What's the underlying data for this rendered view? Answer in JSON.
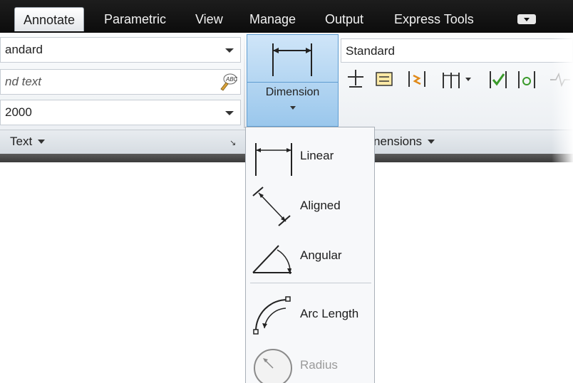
{
  "tabs": [
    {
      "label": "Annotate",
      "active": true
    },
    {
      "label": "Parametric",
      "active": false
    },
    {
      "label": "View",
      "active": false
    },
    {
      "label": "Manage",
      "active": false
    },
    {
      "label": "Output",
      "active": false
    },
    {
      "label": "Express Tools",
      "active": false
    }
  ],
  "text_panel": {
    "style_value": "andard",
    "find_placeholder": "nd text",
    "height_value": "2000",
    "title": "Text"
  },
  "dimensions_panel": {
    "dimension_button_label": "Dimension",
    "style_value": "Standard",
    "title_partial": "nensions"
  },
  "dimension_menu": {
    "items": [
      {
        "label": "Linear",
        "icon": "linear-dimension-icon",
        "enabled": true
      },
      {
        "label": "Aligned",
        "icon": "aligned-dimension-icon",
        "enabled": true
      },
      {
        "label": "Angular",
        "icon": "angular-dimension-icon",
        "enabled": true
      },
      {
        "label": "Arc Length",
        "icon": "arc-length-icon",
        "enabled": true
      },
      {
        "label": "Radius",
        "icon": "radius-icon",
        "enabled": false
      }
    ]
  },
  "colors": {
    "tab_bar": "#121212",
    "selected_button": "#a9d0f0",
    "menu_background": "#f7f8fa"
  }
}
